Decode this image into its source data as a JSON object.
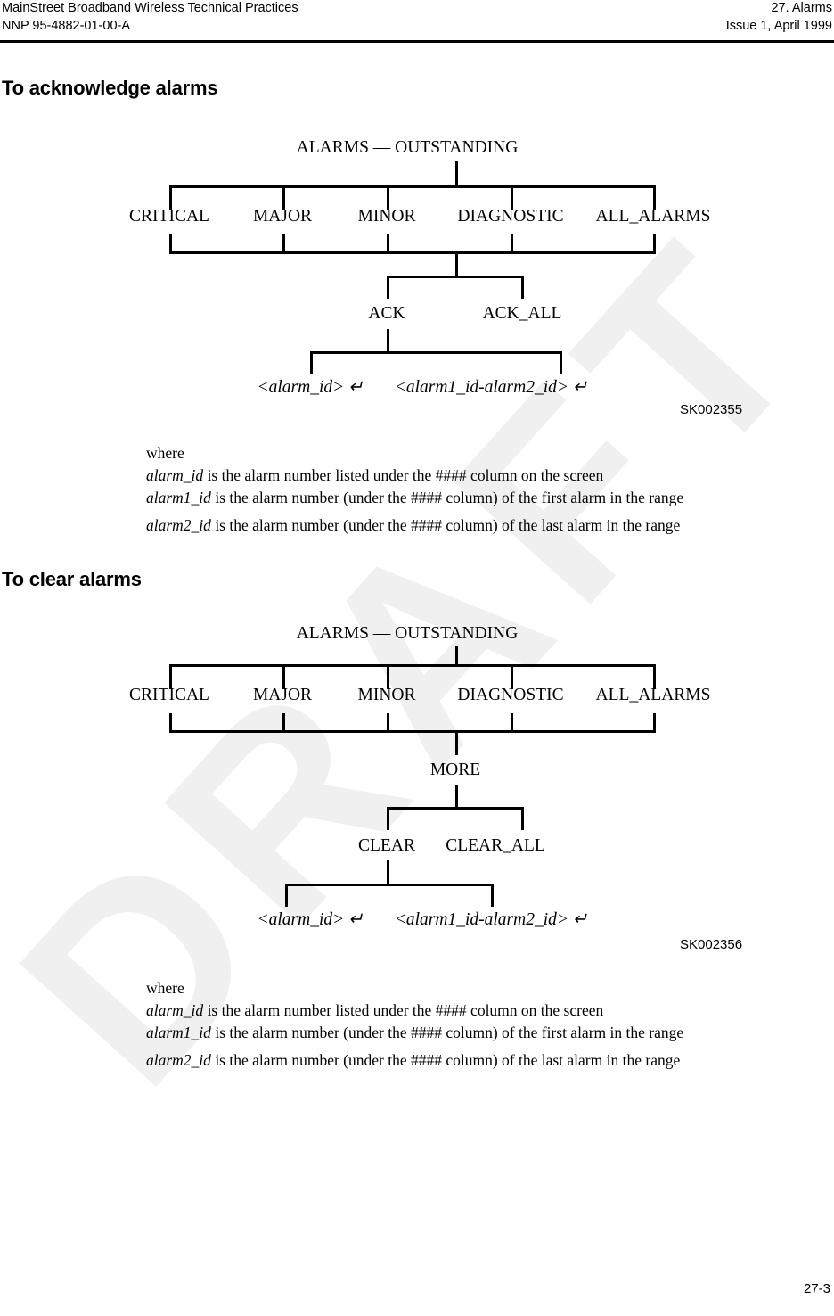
{
  "header": {
    "left_line1": "MainStreet Broadband Wireless Technical Practices",
    "left_line2": "NNP 95-4882-01-00-A",
    "right_line1": "27. Alarms",
    "right_line2": "Issue 1, April 1999"
  },
  "watermark": {
    "text": "DRAFT",
    "color": "#f0f0f0"
  },
  "sections": {
    "acknowledge": {
      "heading": "To acknowledge alarms",
      "figure_id": "SK002355",
      "tree": {
        "root": "ALARMS — OUTSTANDING",
        "level1": [
          "CRITICAL",
          "MAJOR",
          "MINOR",
          "DIAGNOSTIC",
          "ALL_ALARMS"
        ],
        "level2": [
          "ACK",
          "ACK_ALL"
        ],
        "level3": [
          "<alarm_id> ↵",
          "<alarm1_id-alarm2_id> ↵"
        ]
      },
      "where": {
        "label": "where",
        "lines": [
          {
            "term": "alarm_id",
            "text": " is the alarm number listed under the #### column on the screen"
          },
          {
            "term": "alarm1_id",
            "text": " is the alarm number (under the #### column) of the first alarm in the range"
          },
          {
            "term": "alarm2_id",
            "text": " is the alarm number (under the #### column) of the last alarm in the range"
          }
        ]
      }
    },
    "clear": {
      "heading": "To clear alarms",
      "figure_id": "SK002356",
      "tree": {
        "root": "ALARMS — OUTSTANDING",
        "level1": [
          "CRITICAL",
          "MAJOR",
          "MINOR",
          "DIAGNOSTIC",
          "ALL_ALARMS"
        ],
        "level2": [
          "MORE"
        ],
        "level3": [
          "CLEAR",
          "CLEAR_ALL"
        ],
        "level4": [
          "<alarm_id> ↵",
          "<alarm1_id-alarm2_id> ↵"
        ]
      },
      "where": {
        "label": "where",
        "lines": [
          {
            "term": "alarm_id",
            "text": " is the alarm number listed under the #### column on the screen"
          },
          {
            "term": "alarm1_id",
            "text": " is the alarm number (under the #### column) of the first alarm in the range"
          },
          {
            "term": "alarm2_id",
            "text": " is the alarm number (under the #### column) of the last alarm in the range"
          }
        ]
      }
    }
  },
  "footer": {
    "page_number": "27-3"
  }
}
